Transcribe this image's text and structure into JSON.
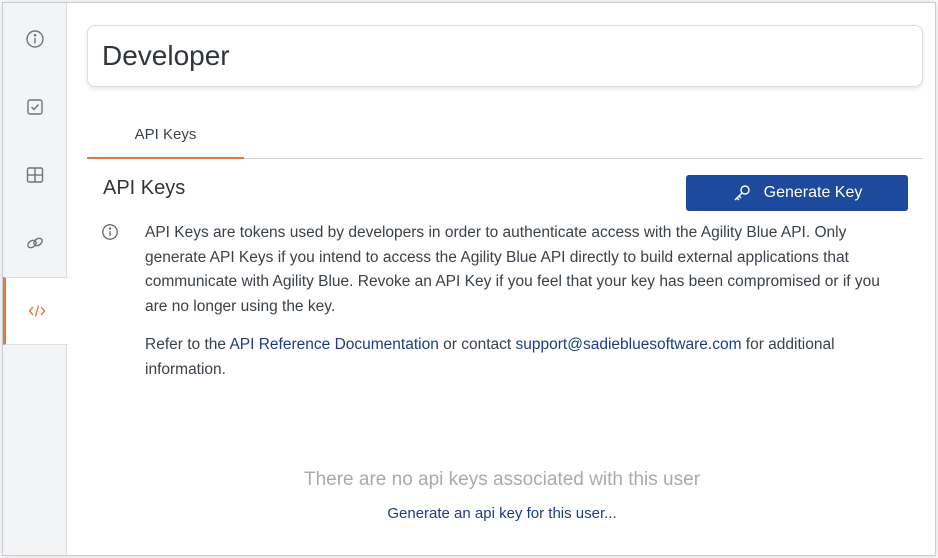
{
  "sidebar": {
    "items": [
      {
        "icon": "info-circle-icon"
      },
      {
        "icon": "checkbox-icon"
      },
      {
        "icon": "grid-icon"
      },
      {
        "icon": "link-icon"
      },
      {
        "icon": "code-icon",
        "active": true
      }
    ]
  },
  "header": {
    "title": "Developer"
  },
  "tabs": [
    {
      "label": "API Keys",
      "active": true
    }
  ],
  "section": {
    "title": "API Keys",
    "generate_button": "Generate Key",
    "description": "API Keys are tokens used by developers in order to authenticate access with the Agility Blue API. Only generate API Keys if you intend to access the Agility Blue API directly to build external applications that communicate with Agility Blue. Revoke an API Key if you feel that your key has been compromised or if you are no longer using the key.",
    "refer_prefix": "Refer to the ",
    "refer_link": "API Reference Documentation",
    "refer_middle": " or contact ",
    "support_email": "support@sadiebluesoftware.com",
    "refer_suffix": " for additional information."
  },
  "empty_state": {
    "message": "There are no api keys associated with this user",
    "action": "Generate an api key for this user..."
  },
  "colors": {
    "accent": "#e07a3f",
    "primary": "#1d4a9c",
    "link": "#1d3c86"
  }
}
